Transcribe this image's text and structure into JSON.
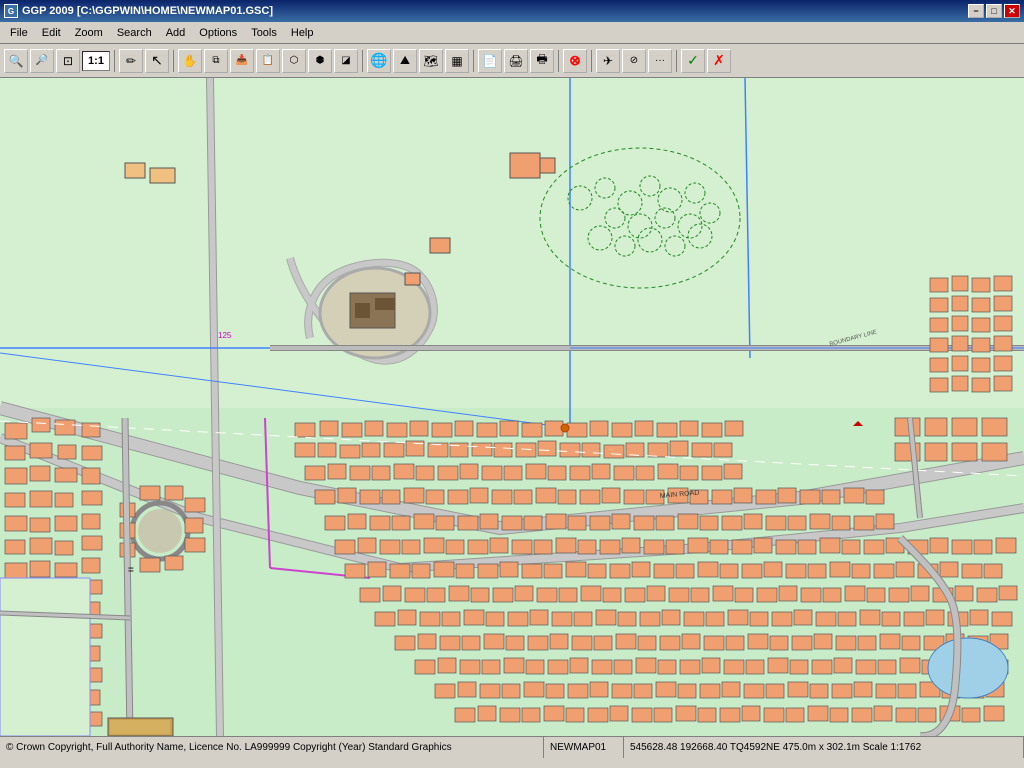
{
  "titlebar": {
    "title": "GGP 2009 [C:\\GGPWIN\\HOME\\NEWMAP01.GSC]",
    "min_label": "−",
    "max_label": "□",
    "close_label": "✕"
  },
  "menubar": {
    "items": [
      {
        "label": "File"
      },
      {
        "label": "Edit"
      },
      {
        "label": "Zoom"
      },
      {
        "label": "Search"
      },
      {
        "label": "Add"
      },
      {
        "label": "Options"
      },
      {
        "label": "Tools"
      },
      {
        "label": "Help"
      }
    ]
  },
  "toolbar": {
    "scale_label": "1:1",
    "buttons": [
      {
        "name": "zoom-in",
        "icon": "🔍+",
        "tooltip": "Zoom In"
      },
      {
        "name": "zoom-out",
        "icon": "🔍-",
        "tooltip": "Zoom Out"
      },
      {
        "name": "zoom-window",
        "icon": "⊞",
        "tooltip": "Zoom Window"
      },
      {
        "name": "scale-box",
        "label": "1:1"
      },
      {
        "name": "pencil",
        "icon": "✏",
        "tooltip": "Draw"
      },
      {
        "name": "select",
        "icon": "↖",
        "tooltip": "Select"
      },
      {
        "name": "move",
        "icon": "✋",
        "tooltip": "Move"
      },
      {
        "name": "copy",
        "icon": "⧉",
        "tooltip": "Copy"
      },
      {
        "name": "paste",
        "icon": "📋",
        "tooltip": "Paste"
      },
      {
        "name": "tool9",
        "icon": "⬡"
      },
      {
        "name": "tool10",
        "icon": "⬢"
      },
      {
        "name": "tool11",
        "icon": "◫"
      },
      {
        "name": "tool12",
        "icon": "⊕"
      },
      {
        "name": "tool13",
        "icon": "🌐"
      },
      {
        "name": "tool14",
        "icon": "⛰"
      },
      {
        "name": "tool15",
        "icon": "🗺"
      },
      {
        "name": "tool16",
        "icon": "🔲"
      },
      {
        "name": "tool17",
        "icon": "📄"
      },
      {
        "name": "tool18",
        "icon": "📑"
      },
      {
        "name": "tool19",
        "icon": "🖨"
      },
      {
        "name": "tool20",
        "icon": "🖶"
      },
      {
        "name": "tool21",
        "icon": "⊗"
      },
      {
        "name": "tool22",
        "icon": "✈"
      },
      {
        "name": "tool23",
        "icon": "⊘"
      },
      {
        "name": "tool24",
        "icon": "⋯"
      },
      {
        "name": "tool25",
        "icon": "✓"
      },
      {
        "name": "tool26",
        "icon": "✗"
      }
    ]
  },
  "statusbar": {
    "copyright": "© Crown Copyright, Full Authority Name, Licence No. LA999999 Copyright (Year)",
    "graphics": "Standard Graphics",
    "coords": "545628.48 192668.40 TQ4592NE 475.0m x 302.1m Scale 1:1762",
    "map_name": "NEWMAP01"
  }
}
